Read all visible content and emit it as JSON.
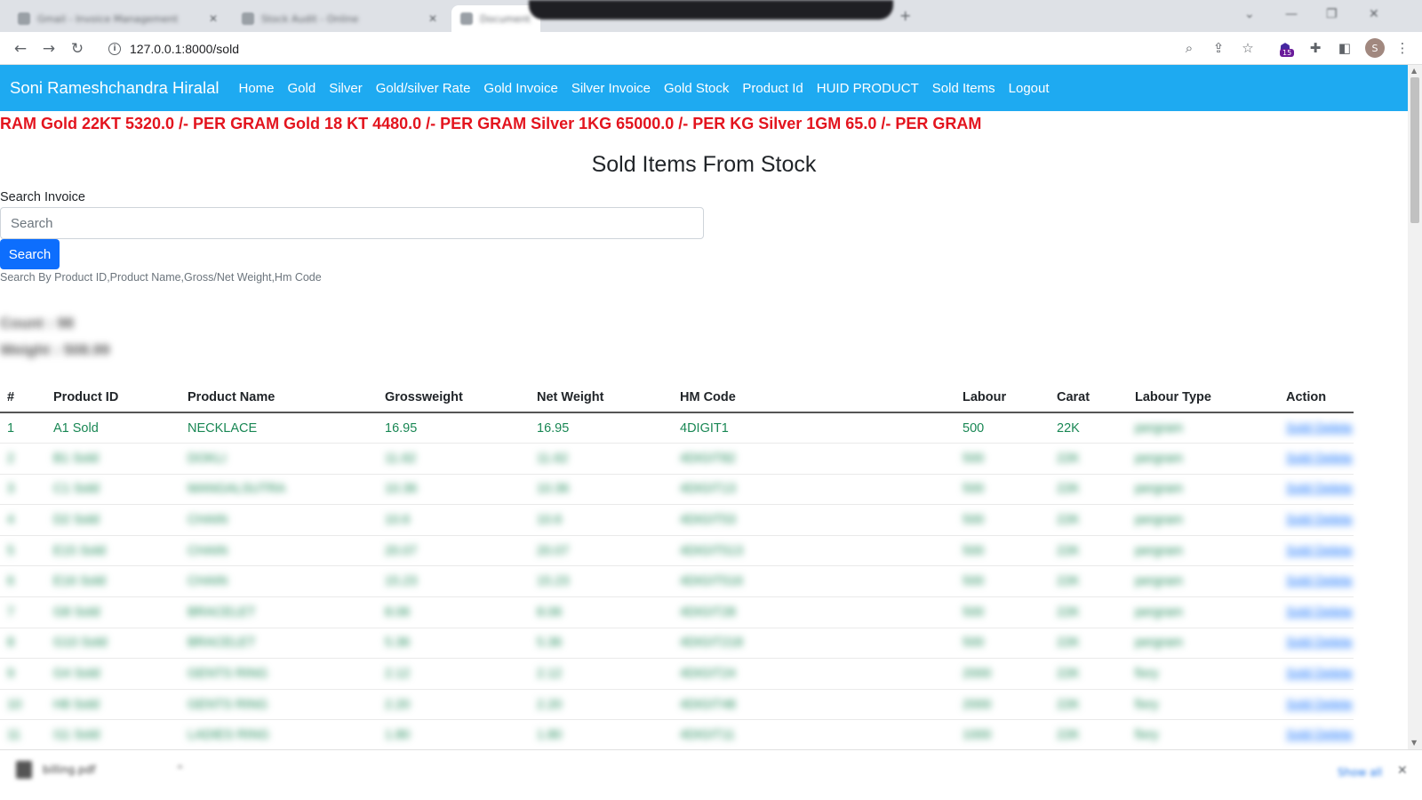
{
  "browser": {
    "tabs": [
      {
        "title": "Gmail - Invoice Management"
      },
      {
        "title": "Stock Audit - Online"
      },
      {
        "title": "Document"
      }
    ],
    "url": "127.0.0.1:8000/sold",
    "extension_badge": "15",
    "profile_initial": "S"
  },
  "navbar": {
    "brand": "Soni Rameshchandra Hiralal",
    "links": [
      "Home",
      "Gold",
      "Silver",
      "Gold/silver Rate",
      "Gold Invoice",
      "Silver Invoice",
      "Gold Stock",
      "Product Id",
      "HUID PRODUCT",
      "Sold Items",
      "Logout"
    ],
    "bg_color": "#1eaaf1"
  },
  "rate_ticker": "RAM Gold 22KT 5320.0 /- PER GRAM Gold 18 KT 4480.0 /- PER GRAM Silver 1KG 65000.0 /- PER KG Silver 1GM 65.0 /- PER GRAM",
  "page_title": "Sold Items From Stock",
  "search": {
    "label": "Search Invoice",
    "placeholder": "Search",
    "value": "",
    "button": "Search",
    "help": "Search By Product ID,Product Name,Gross/Net Weight,Hm Code"
  },
  "summary": {
    "count": "Count : 98",
    "weight": "Weight : 508.99"
  },
  "table": {
    "columns": [
      "#",
      "Product ID",
      "Product Name",
      "Grossweight",
      "Net Weight",
      "HM Code",
      "Labour",
      "Carat",
      "Labour Type",
      "Action"
    ],
    "rows": [
      [
        "1",
        "A1 Sold",
        "NECKLACE",
        "16.95",
        "16.95",
        "4DIGIT1",
        "500",
        "22K",
        "pergram",
        "Sold Delete"
      ],
      [
        "2",
        "B1 Sold",
        "DOKLI",
        "11.62",
        "11.62",
        "4DIGIT82",
        "500",
        "22K",
        "pergram",
        "Sold Delete"
      ],
      [
        "3",
        "C1 Sold",
        "MANGALSUTRA",
        "10.36",
        "10.36",
        "4DIGIT13",
        "500",
        "22K",
        "pergram",
        "Sold Delete"
      ],
      [
        "4",
        "D2 Sold",
        "CHAIN",
        "10.6",
        "10.6",
        "4DIGIT53",
        "500",
        "22K",
        "pergram",
        "Sold Delete"
      ],
      [
        "5",
        "E15 Sold",
        "CHAIN",
        "20.07",
        "20.07",
        "4DIGIT513",
        "500",
        "22K",
        "pergram",
        "Sold Delete"
      ],
      [
        "6",
        "E16 Sold",
        "CHAIN",
        "15.23",
        "15.23",
        "4DIGIT516",
        "500",
        "22K",
        "pergram",
        "Sold Delete"
      ],
      [
        "7",
        "G8 Sold",
        "BRACELET",
        "8.06",
        "8.06",
        "4DIGIT28",
        "500",
        "22K",
        "pergram",
        "Sold Delete"
      ],
      [
        "8",
        "G10 Sold",
        "BRACELET",
        "5.36",
        "5.36",
        "4DIGIT218",
        "500",
        "22K",
        "pergram",
        "Sold Delete"
      ],
      [
        "9",
        "G4 Sold",
        "GENTS RING",
        "2.12",
        "2.12",
        "4DIGIT24",
        "2000",
        "22K",
        "fixry",
        "Sold Delete"
      ],
      [
        "10",
        "H8 Sold",
        "GENTS RING",
        "2.20",
        "2.20",
        "4DIGIT48",
        "2000",
        "22K",
        "fixry",
        "Sold Delete"
      ],
      [
        "11",
        "I11 Sold",
        "LADIES RING",
        "1.80",
        "1.80",
        "4DIGIT11",
        "1000",
        "22K",
        "fixry",
        "Sold Delete"
      ]
    ]
  },
  "downloads": {
    "file": "billing.pdf",
    "show_all": "Show all"
  }
}
